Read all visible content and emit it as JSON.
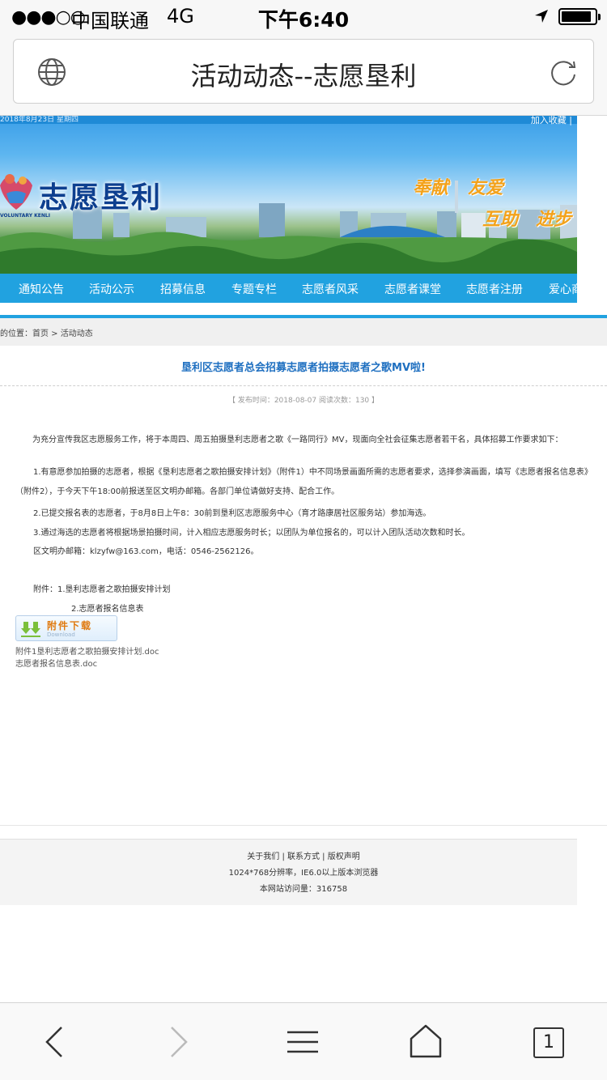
{
  "status_bar": {
    "signal": "●●●○○",
    "carrier": "中国联通",
    "network": "4G",
    "time": "下午6:40"
  },
  "browser": {
    "page_title": "活动动态--志愿垦利",
    "tab_count": "1"
  },
  "banner": {
    "top_date": "2018年8月23日 星期四",
    "add_favorite": "加入收藏 |",
    "site_name": "志愿垦利",
    "logo_subtitle": "VOLUNTARY KENLI",
    "slogans": [
      "奉献",
      "友爱",
      "互助",
      "进步"
    ]
  },
  "nav": {
    "items": [
      "通知公告",
      "活动公示",
      "招募信息",
      "专题专栏",
      "志愿者风采",
      "志愿者课堂",
      "志愿者注册",
      "爱心商"
    ]
  },
  "breadcrumb": {
    "prefix": "的位置：",
    "home": "首页",
    "separator": " > ",
    "current": "活动动态"
  },
  "article": {
    "title": "垦利区志愿者总会招募志愿者拍摄志愿者之歌MV啦!",
    "meta": "【 发布时间：2018-08-07   阅读次数：130 】",
    "intro": "为充分宣传我区志愿服务工作，将于本周四、周五拍摄垦利志愿者之歌《一路同行》MV，现面向全社会征集志愿者若干名，具体招募工作要求如下：",
    "item1": "1.有意愿参加拍摄的志愿者，根据《垦利志愿者之歌拍摄安排计划》（附件1）中不同场景画面所需的志愿者要求，选择参演画面，填写《志愿者报名信息表》（附件2），于今天下午18:00前报送至区文明办邮箱。各部门单位请做好支持、配合工作。",
    "item2": "2.已提交报名表的志愿者，于8月8日上午8：30前到垦利区志愿服务中心（育才路康居社区服务站）参加海选。",
    "item3": "3.通过海选的志愿者将根据场景拍摄时间，计入相应志愿服务时长；以团队为单位报名的，可以计入团队活动次数和时长。",
    "contact": "区文明办邮箱：klzyfw@163.com，电话：0546-2562126。",
    "attachments_label": "附件：1.垦利志愿者之歌拍摄安排计划",
    "attachment2": "2.志愿者报名信息表",
    "download_label": "附件下载",
    "download_sub": "Download",
    "files": [
      "附件1垦利志愿者之歌拍摄安排计划.doc",
      "志愿者报名信息表.doc"
    ]
  },
  "footer": {
    "links": "关于我们 | 联系方式 | 版权声明",
    "resolution": "1024*768分辨率，IE6.0以上版本浏览器",
    "visits": "本网站访问量：316758"
  }
}
